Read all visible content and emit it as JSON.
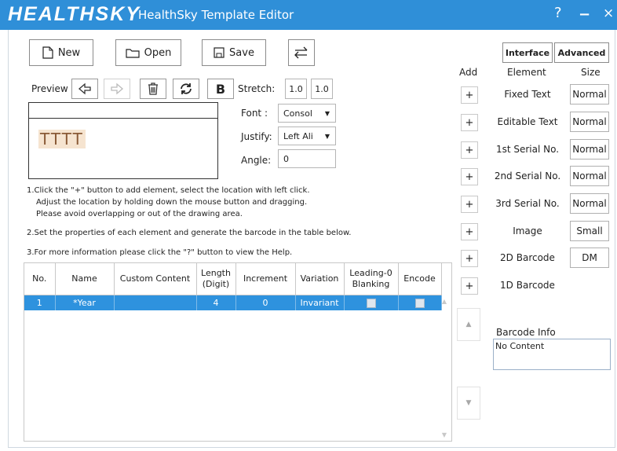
{
  "window": {
    "logo": "HEALTHSKY",
    "title": "HealthSky Template Editor",
    "help_glyph": "?",
    "minimize_glyph": "−",
    "close_glyph": "×"
  },
  "toolbar": {
    "new_label": "New",
    "open_label": "Open",
    "save_label": "Save"
  },
  "preview_bar": {
    "label": "Preview",
    "bold_label": "B"
  },
  "stretch": {
    "label": "Stretch:",
    "x": "1.0",
    "y": "1.0"
  },
  "properties": {
    "font_label": "Font :",
    "font_value": "Consol",
    "justify_label": "Justify:",
    "justify_value": "Left Ali",
    "angle_label": "Angle:",
    "angle_value": "0"
  },
  "preview_text": "TTTT",
  "instructions": {
    "line1": "1.Click the \"+\" button to add element, select the location with left click.",
    "line2": "Adjust the location by holding down the mouse button and dragging.",
    "line3": "Please avoid overlapping or out of the drawing area.",
    "line4": "2.Set the properties of each element and generate the barcode in the table below.",
    "line5": "3.For more information please click the \"?\" button to view the Help."
  },
  "table": {
    "headers": {
      "no": "No.",
      "name": "Name",
      "custom": "Custom Content",
      "length1": "Length",
      "length2": "(Digit)",
      "increment": "Increment",
      "variation": "Variation",
      "lead1": "Leading-0",
      "lead2": "Blanking",
      "encode": "Encode"
    },
    "rows": [
      {
        "no": "1",
        "name": "*Year",
        "custom": "",
        "length": "4",
        "increment": "0",
        "variation": "Invariant"
      }
    ]
  },
  "right_panel": {
    "interface_label": "Interface",
    "advanced_label": "Advanced",
    "add_header": "Add",
    "element_header": "Element",
    "size_header": "Size",
    "plus": "+",
    "elements": [
      {
        "label": "Fixed Text",
        "size": "Normal"
      },
      {
        "label": "Editable Text",
        "size": "Normal"
      },
      {
        "label": "1st Serial No.",
        "size": "Normal"
      },
      {
        "label": "2nd Serial No.",
        "size": "Normal"
      },
      {
        "label": "3rd Serial No.",
        "size": "Normal"
      },
      {
        "label": "Image",
        "size": "Small"
      },
      {
        "label": "2D Barcode",
        "size": "DM"
      },
      {
        "label": "1D Barcode",
        "size": ""
      }
    ],
    "barcode_info_label": "Barcode Info",
    "barcode_info_value": "No Content"
  }
}
